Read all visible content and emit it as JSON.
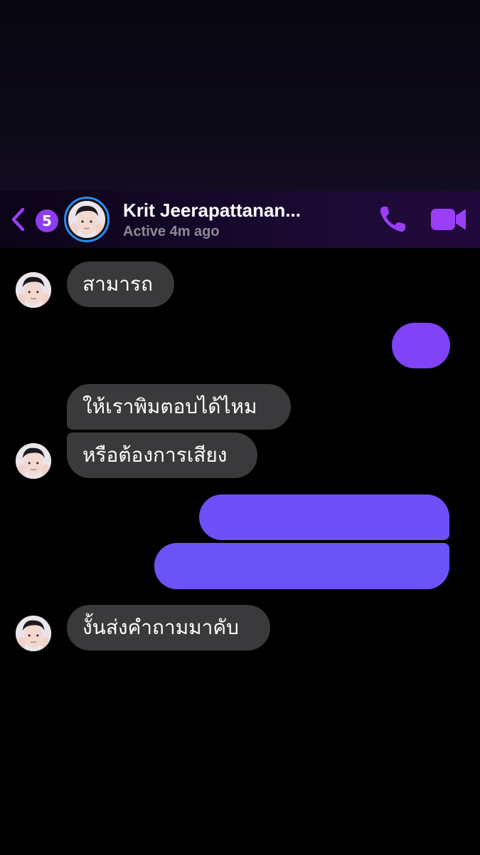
{
  "header": {
    "back_badge": "5",
    "contact_name": "Krit Jeerapattanan...",
    "status": "Active 4m ago"
  },
  "icons": {
    "back": "chevron-left-icon",
    "call": "phone-icon",
    "video": "video-camera-icon"
  },
  "colors": {
    "accent": "#9a3ff5",
    "incoming_bubble": "#3a3a3c",
    "outgoing_bubble": "#7a4cf7",
    "avatar_ring": "#2d8cf0"
  },
  "messages": [
    {
      "direction": "incoming",
      "text": "สามารถ"
    },
    {
      "direction": "outgoing",
      "text": ""
    },
    {
      "direction": "incoming",
      "text": "ให้เราพิมตอบได้ไหม"
    },
    {
      "direction": "incoming",
      "text": "หรือต้องการเสียง"
    },
    {
      "direction": "outgoing",
      "text": ""
    },
    {
      "direction": "outgoing",
      "text": ""
    },
    {
      "direction": "incoming",
      "text": "งั้นส่งคำถามมาคับ"
    }
  ]
}
